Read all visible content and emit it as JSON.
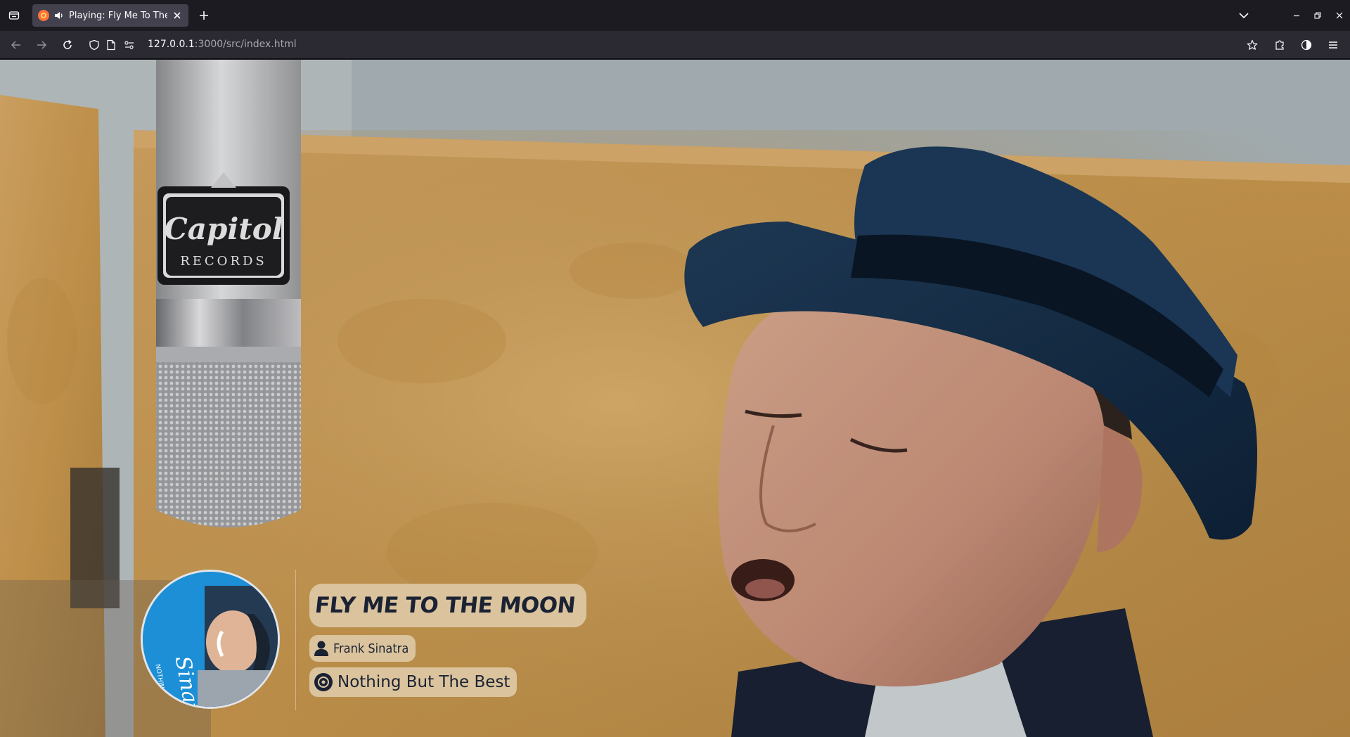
{
  "browser": {
    "tab": {
      "title": "Playing: Fly Me To The Moon",
      "audio_icon": "speaker-icon",
      "favicon": "app-favicon"
    },
    "url": {
      "host": "127.0.0.1",
      "rest": ":3000/src/index.html"
    },
    "toolbar_icons": [
      "back-icon",
      "forward-icon",
      "reload-icon",
      "shield-icon",
      "page-icon",
      "permissions-icon",
      "bookmark-star-icon",
      "extensions-icon",
      "account-icon",
      "menu-icon"
    ]
  },
  "player": {
    "song_title": "FLY ME TO THE MOON",
    "artist": "Frank Sinatra",
    "album": "Nothing But The Best",
    "colors": {
      "pill_bg": "#dec8a4",
      "pill_text": "#1b2233",
      "cover_bg": "#1c8fd6"
    }
  },
  "cover_art": {
    "script_text": "Sinatra",
    "caption": "NOTHING BUT THE BEST"
  },
  "background_art": {
    "mic_brand": "Capitol",
    "mic_subtext": "RECORDS"
  }
}
